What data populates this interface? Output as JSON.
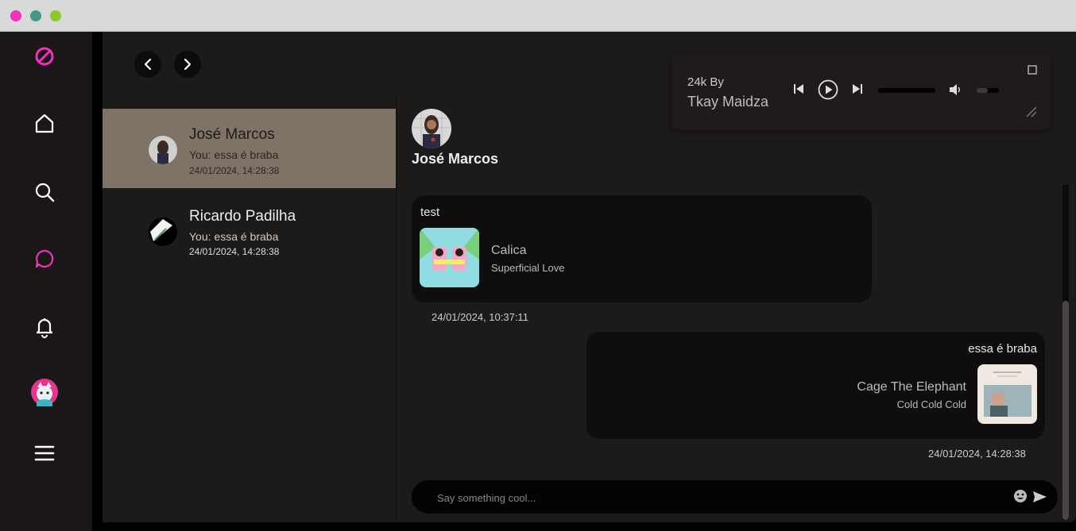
{
  "window": {
    "controls": [
      "close",
      "minimize",
      "maximize"
    ]
  },
  "colors": {
    "accent": "#f72fbf",
    "active_conversation": "#7f7368",
    "panel": "#1d1a1a"
  },
  "sidebar": {
    "items": [
      {
        "icon": "logo-icon"
      },
      {
        "icon": "home-icon"
      },
      {
        "icon": "search-icon"
      },
      {
        "icon": "chat-icon",
        "active": true
      },
      {
        "icon": "bell-icon"
      },
      {
        "icon": "user-avatar"
      },
      {
        "icon": "menu-icon"
      }
    ]
  },
  "conversations": [
    {
      "name": "José Marcos",
      "preview": "You: essa é braba",
      "time": "24/01/2024, 14:28:38",
      "active": true
    },
    {
      "name": "Ricardo Padilha",
      "preview": "You: essa é braba",
      "time": "24/01/2024, 14:28:38",
      "active": false
    }
  ],
  "chat": {
    "header_name": "José Marcos",
    "messages": [
      {
        "text": "test",
        "song": "Calica",
        "artist": "Superficial Love",
        "time": "24/01/2024, 10:37:11",
        "sent": false
      },
      {
        "text": "essa é braba",
        "song": "Cage The Elephant",
        "artist": "Cold Cold Cold",
        "time": "24/01/2024, 14:28:38",
        "sent": true
      }
    ],
    "input_placeholder": "Say something cool..."
  },
  "player": {
    "line1": "24k By",
    "line2": "Tkay Maidza",
    "progress": 0.0,
    "volume": 0.5
  }
}
